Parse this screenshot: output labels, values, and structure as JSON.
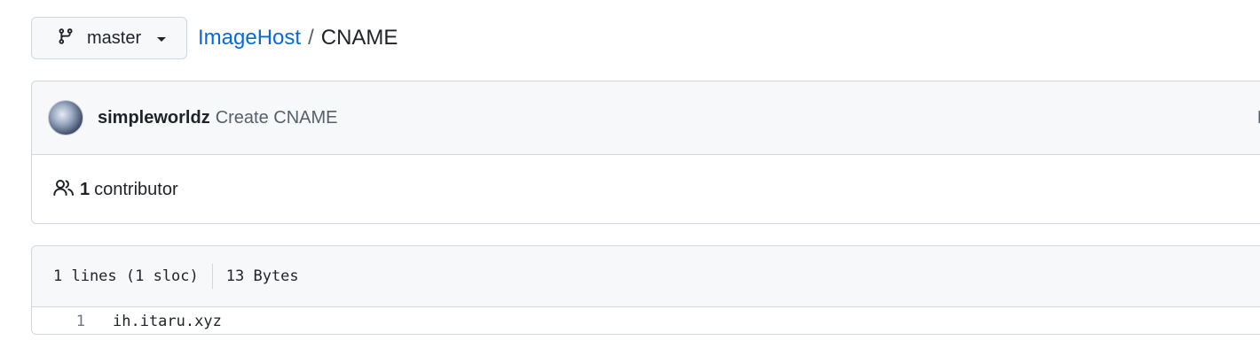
{
  "branch": {
    "label": "master",
    "icon": "git-branch-icon"
  },
  "breadcrumb": {
    "repo": "ImageHost",
    "separator": "/",
    "file": "CNAME"
  },
  "commit": {
    "author": "simpleworldz",
    "message": "Create CNAME",
    "truncated_text": "L"
  },
  "contributors": {
    "count": "1",
    "label": "contributor",
    "icon": "people-icon"
  },
  "file_info": {
    "lines": "1 lines (1 sloc)",
    "size": "13 Bytes"
  },
  "code": {
    "lines": [
      {
        "number": "1",
        "text": "ih.itaru.xyz"
      }
    ]
  },
  "colors": {
    "link": "#0969da",
    "border": "#d0d7de",
    "header_bg": "#f6f8fa"
  }
}
